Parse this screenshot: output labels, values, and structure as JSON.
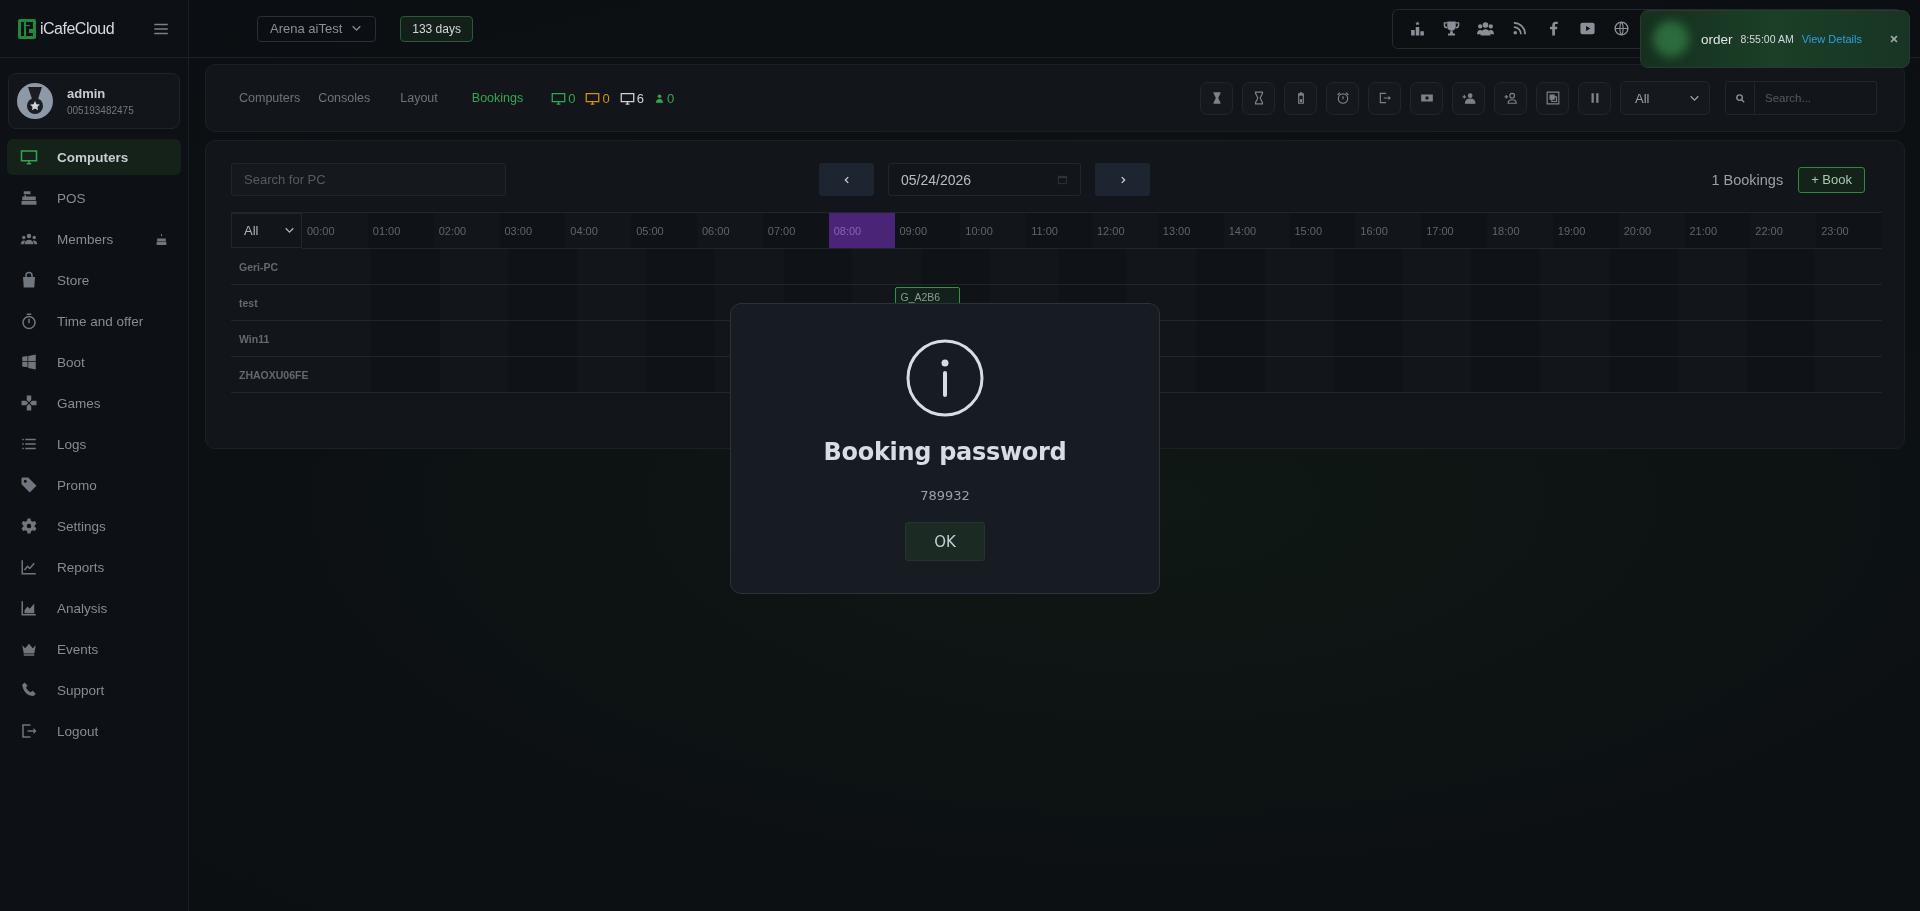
{
  "brand": {
    "name": "iCafeCloud"
  },
  "topbar": {
    "cafe_select": "Arena aiTest",
    "license_badge": "133 days"
  },
  "notification": {
    "title": "order",
    "time": "8:55:00 AM",
    "link": "View Details"
  },
  "user": {
    "name": "admin",
    "id": "005193482475"
  },
  "sidebar": {
    "items": [
      {
        "label": "Computers",
        "selected": true,
        "birthday_alert": false
      },
      {
        "label": "POS",
        "selected": false,
        "birthday_alert": false
      },
      {
        "label": "Members",
        "selected": false,
        "birthday_alert": true
      },
      {
        "label": "Store",
        "selected": false,
        "birthday_alert": false
      },
      {
        "label": "Time and offer",
        "selected": false,
        "birthday_alert": false
      },
      {
        "label": "Boot",
        "selected": false,
        "birthday_alert": false
      },
      {
        "label": "Games",
        "selected": false,
        "birthday_alert": false
      },
      {
        "label": "Logs",
        "selected": false,
        "birthday_alert": false
      },
      {
        "label": "Promo",
        "selected": false,
        "birthday_alert": false
      },
      {
        "label": "Settings",
        "selected": false,
        "birthday_alert": false
      },
      {
        "label": "Reports",
        "selected": false,
        "birthday_alert": false
      },
      {
        "label": "Analysis",
        "selected": false,
        "birthday_alert": false
      },
      {
        "label": "Events",
        "selected": false,
        "birthday_alert": false
      },
      {
        "label": "Support",
        "selected": false,
        "birthday_alert": false
      },
      {
        "label": "Logout",
        "selected": false,
        "birthday_alert": false
      }
    ]
  },
  "tabs": [
    {
      "label": "Computers",
      "selected": false
    },
    {
      "label": "Consoles",
      "selected": false
    },
    {
      "label": "Layout",
      "selected": false
    },
    {
      "label": "Bookings",
      "selected": true
    }
  ],
  "counters": [
    {
      "kind": "monitor",
      "value": "0",
      "color": "#2fa84f"
    },
    {
      "kind": "monitor",
      "value": "0",
      "color": "#d9900f"
    },
    {
      "kind": "monitor",
      "value": "6",
      "color": "#d0d4d8"
    },
    {
      "kind": "person",
      "value": "0",
      "color": "#2fa84f"
    }
  ],
  "toolbar": {
    "filter": "All",
    "search": {
      "placeholder": "Search..."
    }
  },
  "bookings": {
    "search": {
      "placeholder": "Search for PC"
    },
    "date": "05/24/2026",
    "count": "1 Bookings",
    "book_button": "+ Book",
    "filter": "All",
    "hours": [
      {
        "label": "00:00",
        "selected": false
      },
      {
        "label": "01:00",
        "selected": false
      },
      {
        "label": "02:00",
        "selected": false
      },
      {
        "label": "03:00",
        "selected": false
      },
      {
        "label": "04:00",
        "selected": false
      },
      {
        "label": "05:00",
        "selected": false
      },
      {
        "label": "06:00",
        "selected": false
      },
      {
        "label": "07:00",
        "selected": false
      },
      {
        "label": "08:00",
        "selected": true
      },
      {
        "label": "09:00",
        "selected": false
      },
      {
        "label": "10:00",
        "selected": false
      },
      {
        "label": "11:00",
        "selected": false
      },
      {
        "label": "12:00",
        "selected": false
      },
      {
        "label": "13:00",
        "selected": false
      },
      {
        "label": "14:00",
        "selected": false
      },
      {
        "label": "15:00",
        "selected": false
      },
      {
        "label": "16:00",
        "selected": false
      },
      {
        "label": "17:00",
        "selected": false
      },
      {
        "label": "18:00",
        "selected": false
      },
      {
        "label": "19:00",
        "selected": false
      },
      {
        "label": "20:00",
        "selected": false
      },
      {
        "label": "21:00",
        "selected": false
      },
      {
        "label": "22:00",
        "selected": false
      },
      {
        "label": "23:00",
        "selected": false
      }
    ],
    "rows": [
      {
        "name": "Geri-PC",
        "bookings": []
      },
      {
        "name": "test",
        "bookings": [
          {
            "label": "G_A2B6"
          }
        ]
      },
      {
        "name": "Win11",
        "bookings": []
      },
      {
        "name": "ZHAOXU06FE",
        "bookings": []
      }
    ]
  },
  "dialog": {
    "title": "Booking password",
    "message": "789932",
    "button": "OK"
  }
}
